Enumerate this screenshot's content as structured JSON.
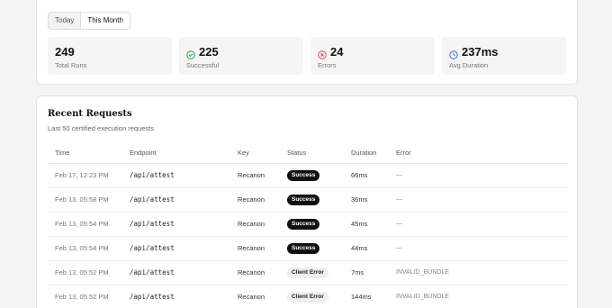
{
  "filters": {
    "tabs": [
      "Today",
      "This Month"
    ],
    "active": "This Month"
  },
  "stats": [
    {
      "value": "249",
      "label": "Total Runs",
      "icon": ""
    },
    {
      "value": "225",
      "label": "Successful",
      "icon": "check-circle-icon",
      "color": "#2e9e5b"
    },
    {
      "value": "24",
      "label": "Errors",
      "icon": "x-circle-icon",
      "color": "#d9534f"
    },
    {
      "value": "237ms",
      "label": "Avg Duration",
      "icon": "clock-icon",
      "color": "#4a6fd1"
    }
  ],
  "requests": {
    "title": "Recent Requests",
    "subtitle": "Last 50 certified execution requests",
    "columns": [
      "Time",
      "Endpoint",
      "Key",
      "Status",
      "Duration",
      "Error"
    ],
    "rows": [
      {
        "time": "Feb 17, 12:23 PM",
        "endpoint": "/api/attest",
        "key": "Recanon",
        "status": "Success",
        "duration": "66ms",
        "error": "—"
      },
      {
        "time": "Feb 13, 05:58 PM",
        "endpoint": "/api/attest",
        "key": "Recanon",
        "status": "Success",
        "duration": "36ms",
        "error": "—"
      },
      {
        "time": "Feb 13, 05:54 PM",
        "endpoint": "/api/attest",
        "key": "Recanon",
        "status": "Success",
        "duration": "45ms",
        "error": "—"
      },
      {
        "time": "Feb 13, 05:54 PM",
        "endpoint": "/api/attest",
        "key": "Recanon",
        "status": "Success",
        "duration": "44ms",
        "error": "—"
      },
      {
        "time": "Feb 13, 05:52 PM",
        "endpoint": "/api/attest",
        "key": "Recanon",
        "status": "Client Error",
        "duration": "7ms",
        "error": "INVALID_BUNDLE"
      },
      {
        "time": "Feb 13, 05:52 PM",
        "endpoint": "/api/attest",
        "key": "Recanon",
        "status": "Client Error",
        "duration": "144ms",
        "error": "INVALID_BUNDLE"
      }
    ]
  }
}
